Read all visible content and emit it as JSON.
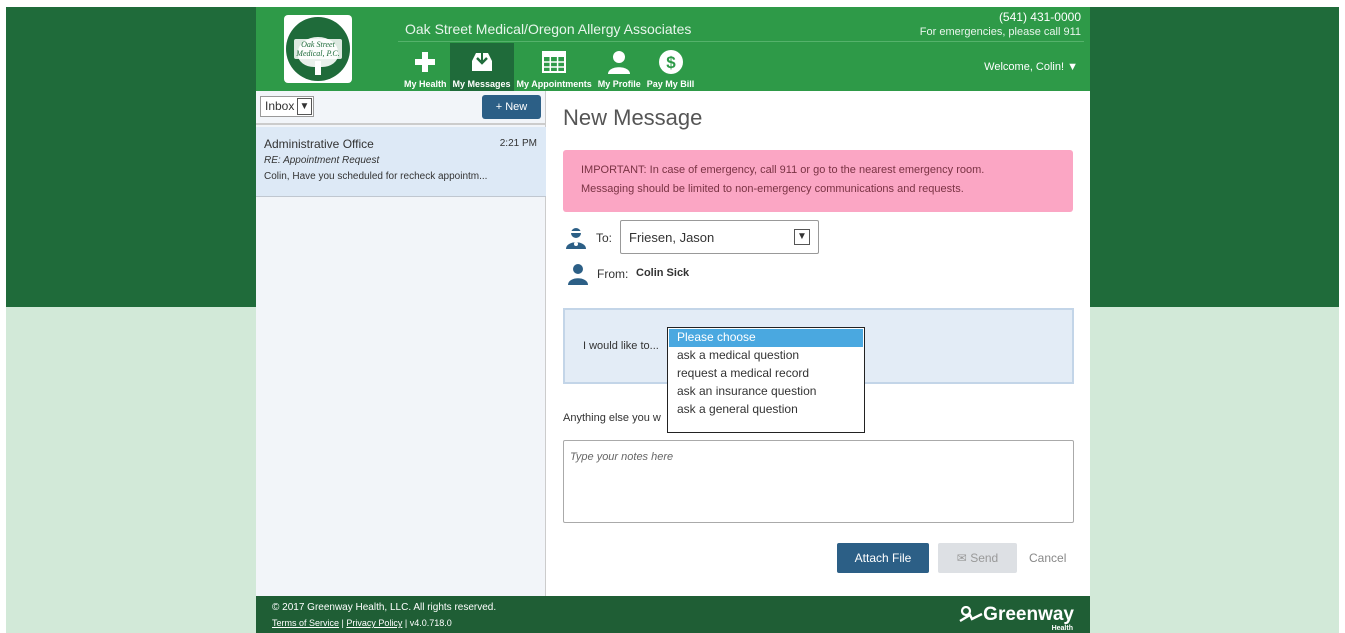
{
  "practice": {
    "logo_line1": "Oak Street",
    "logo_line2": "Medical, P.C.",
    "name": "Oak Street Medical/Oregon Allergy Associates",
    "phone": "(541) 431-0000",
    "emergency_note": "For emergencies, please call 911"
  },
  "nav": {
    "items": [
      {
        "label": "My Health",
        "icon": "plus-icon"
      },
      {
        "label": "My Messages",
        "icon": "inbox-icon"
      },
      {
        "label": "My Appointments",
        "icon": "calendar-icon"
      },
      {
        "label": "My Profile",
        "icon": "person-icon"
      },
      {
        "label": "Pay My Bill",
        "icon": "dollar-icon"
      }
    ],
    "active": "My Messages",
    "welcome": "Welcome, Colin! ▼"
  },
  "sidebar": {
    "folder": "Inbox",
    "new_label": "+ New",
    "messages": [
      {
        "from": "Administrative Office",
        "time": "2:21 PM",
        "subject": "RE: Appointment Request",
        "preview": "Colin, Have you scheduled for recheck appointm..."
      }
    ]
  },
  "compose": {
    "title": "New Message",
    "alert_line1": "IMPORTANT: In case of emergency, call 911 or go to the nearest emergency room.",
    "alert_line2": "Messaging should be limited to non-emergency communications and requests.",
    "to_label": "To:",
    "to_value": "Friesen, Jason",
    "from_label": "From:",
    "from_value": "Colin Sick",
    "intent_label": "I would like to...",
    "intent_options": [
      "Please choose",
      "ask a medical question",
      "request a medical record",
      "ask an insurance question",
      "ask a general question"
    ],
    "intent_selected": "Please choose",
    "anything_label": "Anything else you w",
    "notes_placeholder": "Type your notes here",
    "attach_label": "Attach File",
    "send_label": "Send",
    "cancel_label": "Cancel"
  },
  "footer": {
    "copyright": "© 2017 Greenway Health, LLC. All rights reserved.",
    "terms": "Terms of Service",
    "privacy": "Privacy Policy",
    "version": "v4.0.718.0",
    "brand": "Greenway",
    "brand_sub": "Health"
  },
  "colors": {
    "header_green": "#2e9a48",
    "dark_green": "#1f6b3a",
    "button_blue": "#2c5f86",
    "alert_pink": "#fba6c4",
    "selected_option": "#4aa8e0"
  }
}
